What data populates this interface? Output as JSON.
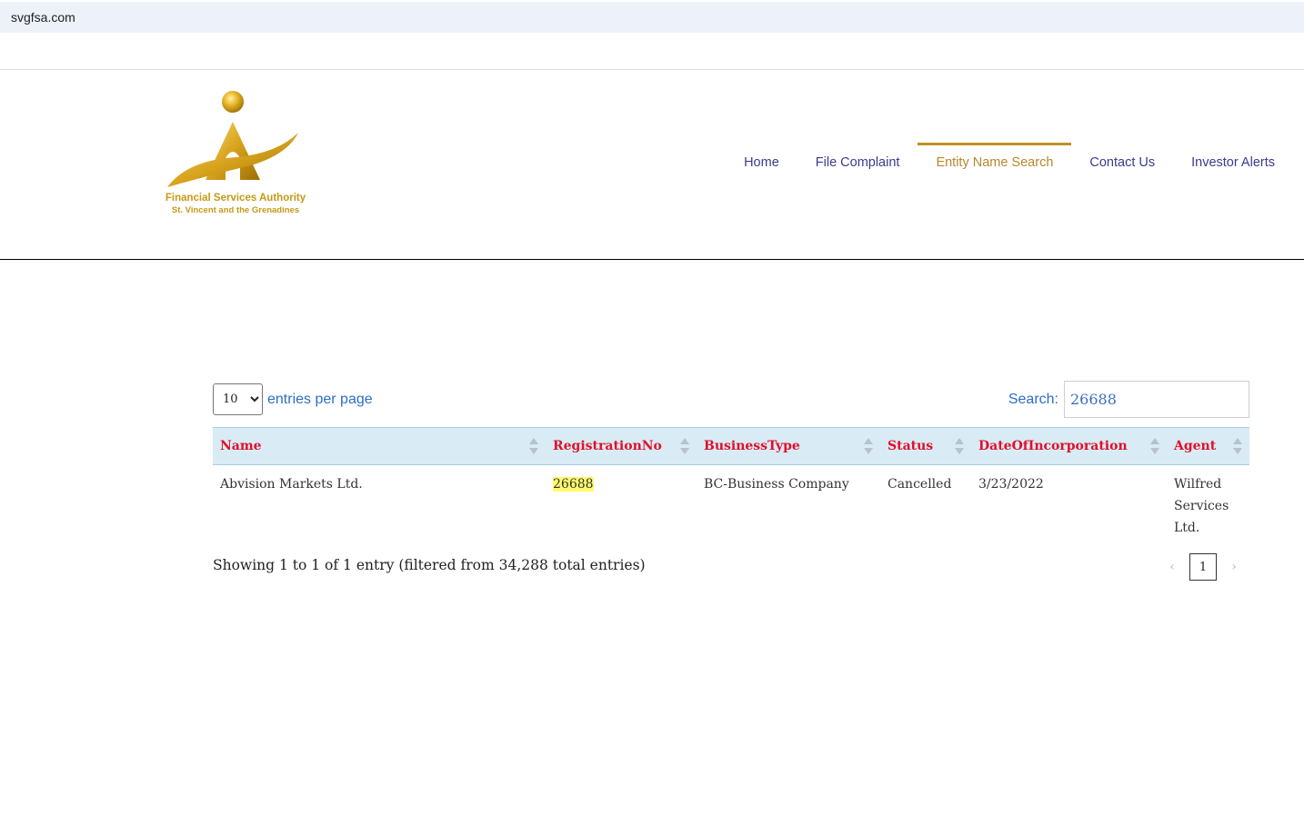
{
  "browser": {
    "url": "svgfsa.com"
  },
  "logo": {
    "line1": "Financial Services Authority",
    "line2": "St. Vincent and the Grenadines"
  },
  "nav": {
    "items": [
      {
        "label": "Home"
      },
      {
        "label": "File Complaint"
      },
      {
        "label": "Entity Name Search"
      },
      {
        "label": "Contact Us"
      },
      {
        "label": "Investor Alerts"
      }
    ],
    "active": "Entity Name Search"
  },
  "controls": {
    "per_page_value": "10",
    "per_page_label": "entries per page",
    "search_label": "Search:",
    "search_value": "26688"
  },
  "table": {
    "columns": [
      "Name",
      "RegistrationNo",
      "BusinessType",
      "Status",
      "DateOfIncorporation",
      "Agent"
    ],
    "rows": [
      {
        "name": "Abvision Markets Ltd.",
        "registration_no": "26688",
        "business_type": "BC-Business Company",
        "status": "Cancelled",
        "date_of_incorporation": "3/23/2022",
        "agent": "Wilfred Services Ltd."
      }
    ]
  },
  "footer": {
    "info": "Showing 1 to 1 of 1 entry (filtered from 34,288 total entries)",
    "prev": "‹",
    "page": "1",
    "next": "›"
  },
  "colors": {
    "nav_link": "#3b3a8f",
    "nav_active": "#b8862b",
    "header_text": "#e0102a",
    "header_bg": "#d9ebf5",
    "label_blue": "#2c6ec6",
    "highlight": "#fff96b",
    "logo_gold": "#c49a17"
  }
}
